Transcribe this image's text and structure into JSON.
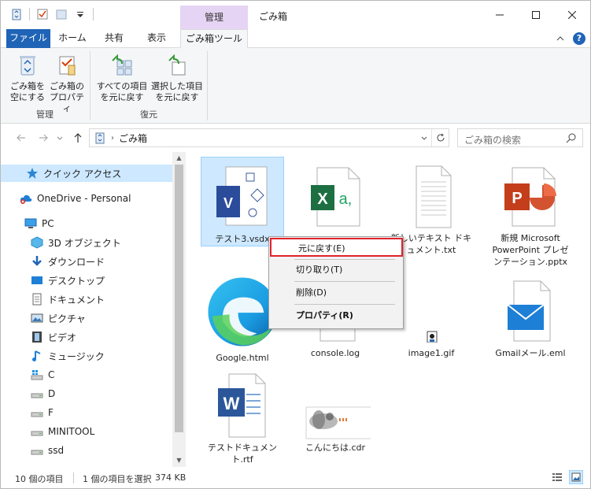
{
  "window": {
    "title": "ごみ箱",
    "context_tab_header": "管理"
  },
  "ribbon_tabs": {
    "file": "ファイル",
    "home": "ホーム",
    "share": "共有",
    "view": "表示",
    "recycle_tools": "ごみ箱ツール"
  },
  "ribbon": {
    "manage_group": {
      "label": "管理",
      "empty_btn_line1": "ごみ箱を",
      "empty_btn_line2": "空にする",
      "props_btn_line1": "ごみ箱の",
      "props_btn_line2": "プロパティ"
    },
    "restore_group": {
      "label": "復元",
      "restore_all_line1": "すべての項目",
      "restore_all_line2": "を元に戻す",
      "restore_sel_line1": "選択した項目",
      "restore_sel_line2": "を元に戻す"
    }
  },
  "address": {
    "crumb": "ごみ箱",
    "search_placeholder": "ごみ箱の検索"
  },
  "navpane": {
    "items": [
      {
        "label": "クイック アクセス"
      },
      {
        "label": "OneDrive - Personal"
      },
      {
        "label": "PC"
      },
      {
        "label": "3D オブジェクト"
      },
      {
        "label": "ダウンロード"
      },
      {
        "label": "デスクトップ"
      },
      {
        "label": "ドキュメント"
      },
      {
        "label": "ピクチャ"
      },
      {
        "label": "ビデオ"
      },
      {
        "label": "ミュージック"
      },
      {
        "label": "C"
      },
      {
        "label": "D"
      },
      {
        "label": "F"
      },
      {
        "label": "MINITOOL"
      },
      {
        "label": "ssd"
      }
    ]
  },
  "files": [
    {
      "name": "テスト3.vsdx"
    },
    {
      "name": ""
    },
    {
      "name": "新しいテキスト ドキュメント.txt"
    },
    {
      "name": "新規 Microsoft PowerPoint プレゼンテーション.pptx"
    },
    {
      "name": "Google.html"
    },
    {
      "name": "console.log"
    },
    {
      "name": "image1.gif"
    },
    {
      "name": "Gmailメール.eml"
    },
    {
      "name": "テストドキュメント.rtf"
    },
    {
      "name": "こんにちは.cdr"
    }
  ],
  "context_menu": {
    "restore": "元に戻す(E)",
    "cut": "切り取り(T)",
    "delete": "削除(D)",
    "properties": "プロパティ(R)"
  },
  "status": {
    "item_count": "10 個の項目",
    "selection": "1 個の項目を選択",
    "size": "374 KB"
  },
  "colors": {
    "accent": "#1f64b6",
    "context_tab": "#e6d4f4",
    "selection": "#cde8ff",
    "highlight_border": "#e0232c"
  }
}
